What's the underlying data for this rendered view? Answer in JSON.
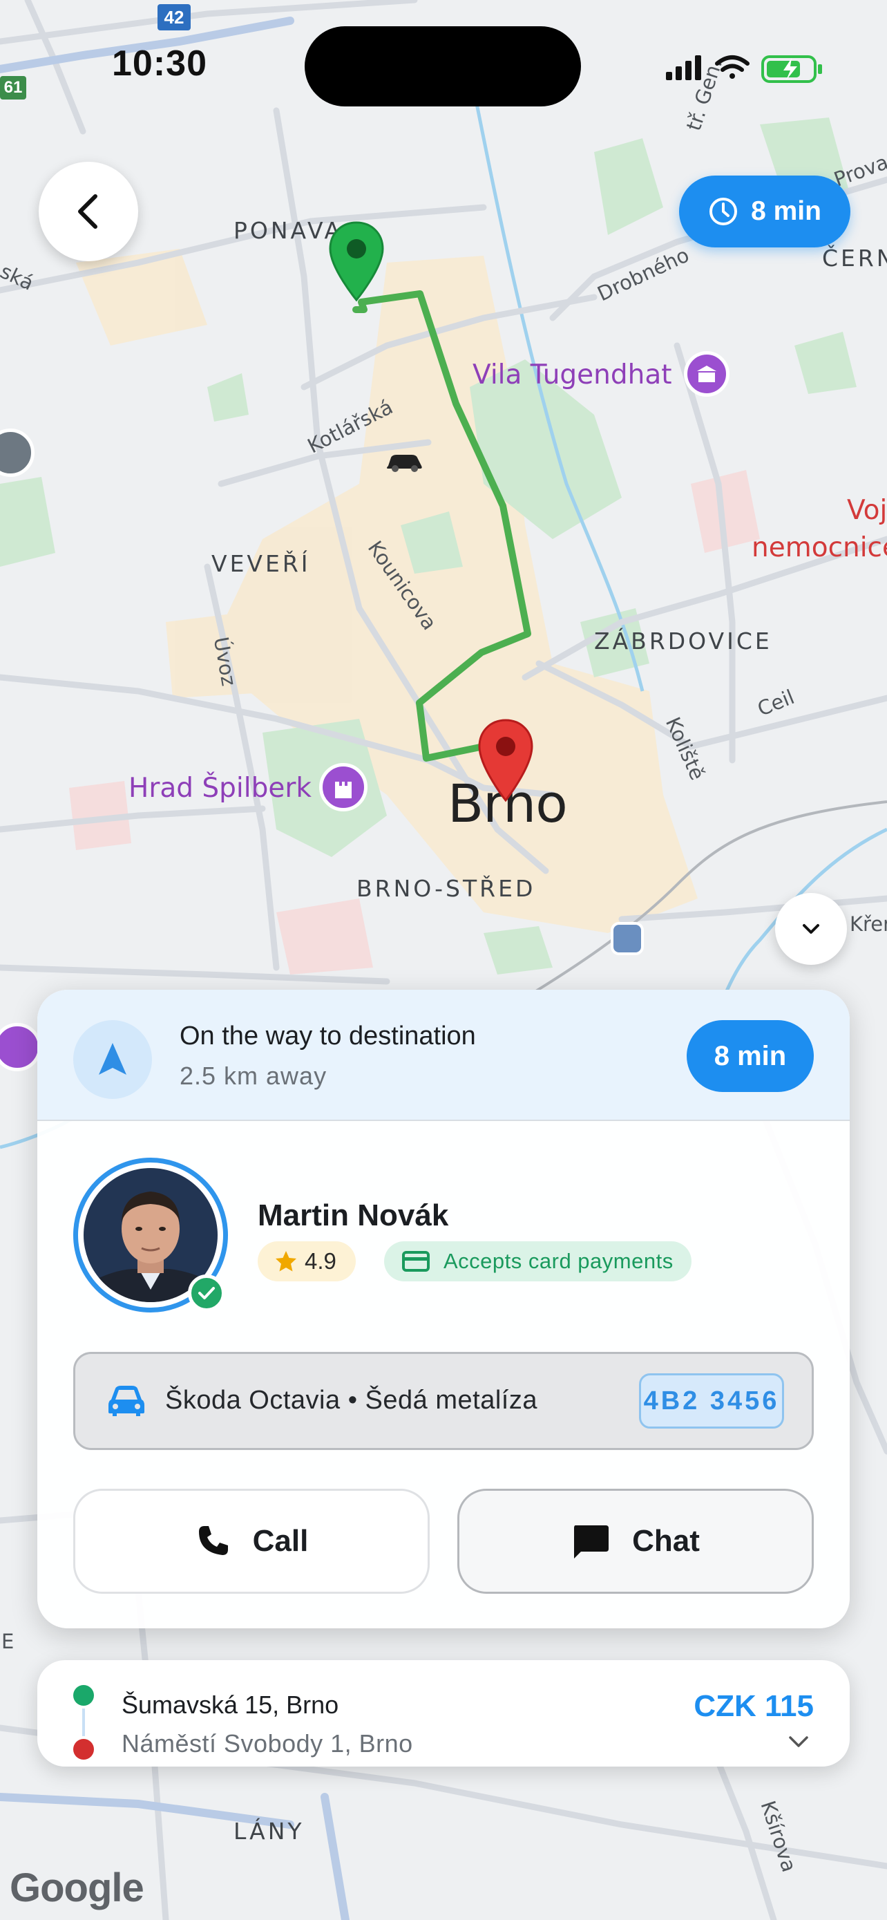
{
  "status_bar": {
    "time": "10:30"
  },
  "map": {
    "labels": {
      "ponava": "PONAVA",
      "veveri": "VEVEŘÍ",
      "zabrdovice": "ZÁBRDOVICE",
      "brno": "Brno",
      "brno_stred": "BRNO-STŘED",
      "lany": "LÁNY",
      "cern": "ČERN",
      "kotlarska": "Kotlářská",
      "kounicova": "Kounicova",
      "uvoz": "Úvoz",
      "drobneho": "Drobného",
      "ceil": "Ceil",
      "koliste": "Koliště",
      "gen": "tř. Gen.",
      "prova": "Prova",
      "ska": "ská",
      "krena": "Křen",
      "vila": "Vila Tugendhat",
      "spilberk": "Hrad Špilberk",
      "voj": "Voj",
      "nemocnice": "nemocnice",
      "road_42": "42",
      "road_61": "61",
      "kosirova": "Kšírova",
      "e": "E"
    },
    "attribution": "Google"
  },
  "eta_badge": {
    "label": "8 min"
  },
  "trip_status": {
    "title": "On the way to destination",
    "subtitle": "2.5 km away",
    "eta": "8 min"
  },
  "driver": {
    "name": "Martin Novák",
    "rating": "4.9",
    "payment_badge": "Accepts card payments"
  },
  "vehicle": {
    "description": "Škoda Octavia • Šedá metalíza",
    "plate": "4B2 3456"
  },
  "actions": {
    "call": "Call",
    "chat": "Chat"
  },
  "route": {
    "from": "Šumavská 15, Brno",
    "to": "Náměstí Svobody 1, Brno",
    "price": "CZK 115"
  },
  "colors": {
    "accent": "#1d8ef0",
    "route": "#4caf50",
    "origin": "#22a867",
    "destination": "#d32f2f"
  }
}
